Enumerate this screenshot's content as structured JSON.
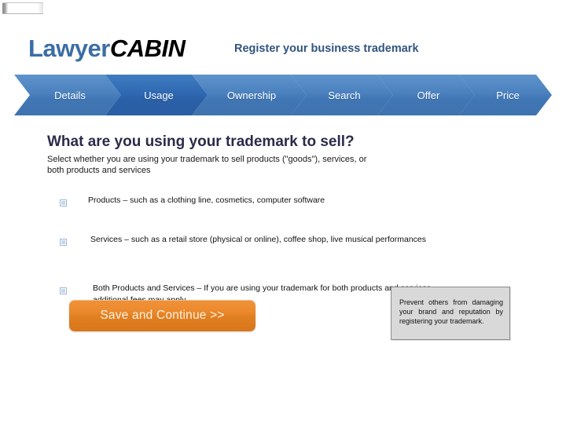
{
  "artifact": {
    "name": "scan-artifact"
  },
  "header": {
    "logo_primary": "Lawyer",
    "logo_secondary": "CABIN",
    "tagline": "Register your business trademark",
    "logo_primary_color": "#3b6ea5",
    "logo_secondary_color": "#000000",
    "tagline_color": "#31557f"
  },
  "steps": {
    "active_index": 1,
    "active_color": "#2a60a8",
    "inactive_color": "#4a81be",
    "items": [
      {
        "label": "Details",
        "active": false
      },
      {
        "label": "Usage",
        "active": true
      },
      {
        "label": "Ownership",
        "active": false
      },
      {
        "label": "Search",
        "active": false
      },
      {
        "label": "Offer",
        "active": false
      },
      {
        "label": "Price",
        "active": false
      }
    ]
  },
  "main": {
    "title": "What are you using your trademark to sell?",
    "title_color": "#2b2b4a",
    "subtitle": "Select whether you are using your trademark to sell products (\"goods\"), services, or both products and services",
    "options": [
      {
        "label": "Products – such as a clothing line, cosmetics, computer software",
        "checked": false
      },
      {
        "label": "Services – such as a retail store (physical or online), coffee shop, live musical performances",
        "checked": false
      },
      {
        "label": "Both Products and Services – If you are using your trademark for both products and services, additional fees may apply.",
        "checked": false
      }
    ]
  },
  "actions": {
    "save_label": "Save and Continue >>",
    "save_color": "#e07f22"
  },
  "info": {
    "text": "Prevent others from damaging your brand and reputation by registering your trademark.",
    "background": "#d9d9d9",
    "border": "#8b8b8b"
  }
}
